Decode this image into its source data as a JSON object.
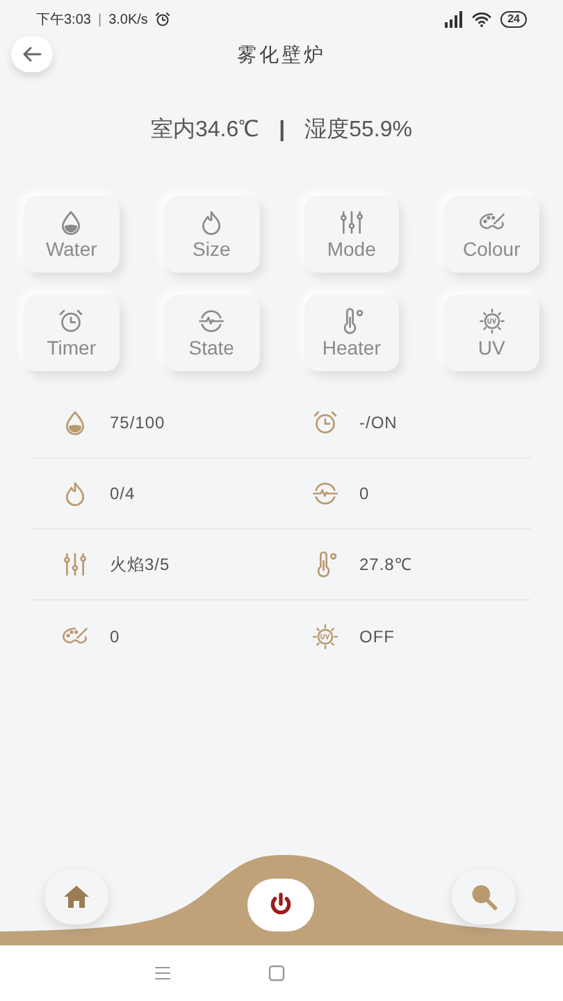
{
  "status_bar": {
    "time": "下午3:03",
    "separator": "|",
    "speed": "3.0K/s",
    "battery": "24"
  },
  "header": {
    "title": "雾化壁炉"
  },
  "climate": {
    "indoor": "室内34.6℃",
    "divider": "|",
    "humidity": "湿度55.9%"
  },
  "controls": [
    {
      "label": "Water"
    },
    {
      "label": "Size"
    },
    {
      "label": "Mode"
    },
    {
      "label": "Colour"
    },
    {
      "label": "Timer"
    },
    {
      "label": "State"
    },
    {
      "label": "Heater"
    },
    {
      "label": "UV"
    }
  ],
  "readings": [
    {
      "value": "75/100"
    },
    {
      "value": "-/ON"
    },
    {
      "value": "0/4"
    },
    {
      "value": "0"
    },
    {
      "value": "火焰3/5"
    },
    {
      "value": "27.8℃"
    },
    {
      "value": "0"
    },
    {
      "value": "OFF"
    }
  ]
}
